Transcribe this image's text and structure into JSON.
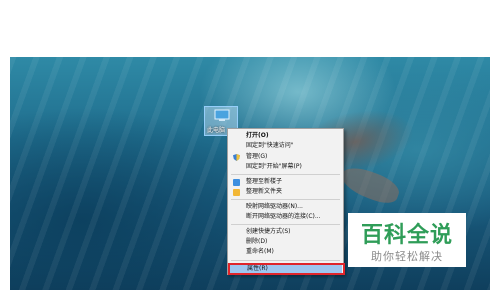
{
  "desktop": {
    "icon_label": "此电脑"
  },
  "context_menu": {
    "items": [
      {
        "label": "打开(O)"
      },
      {
        "label": "固定到\"快速访问\""
      },
      {
        "label": "管理(G)"
      },
      {
        "label": "固定到\"开始\"屏幕(P)"
      },
      {
        "label": "整理至新楼子"
      },
      {
        "label": "整理新文件夹"
      },
      {
        "label": "映射网络驱动器(N)..."
      },
      {
        "label": "断开网络驱动器的连接(C)..."
      },
      {
        "label": "创建快捷方式(S)"
      },
      {
        "label": "删除(D)"
      },
      {
        "label": "重命名(M)"
      },
      {
        "label": "属性(R)"
      }
    ],
    "highlight_color": "#9ec6ef",
    "annotation_color": "#e0252b"
  },
  "watermark": {
    "title": "百科全说",
    "subtitle": "助你轻松解决",
    "brand_color": "#2f9d58"
  }
}
